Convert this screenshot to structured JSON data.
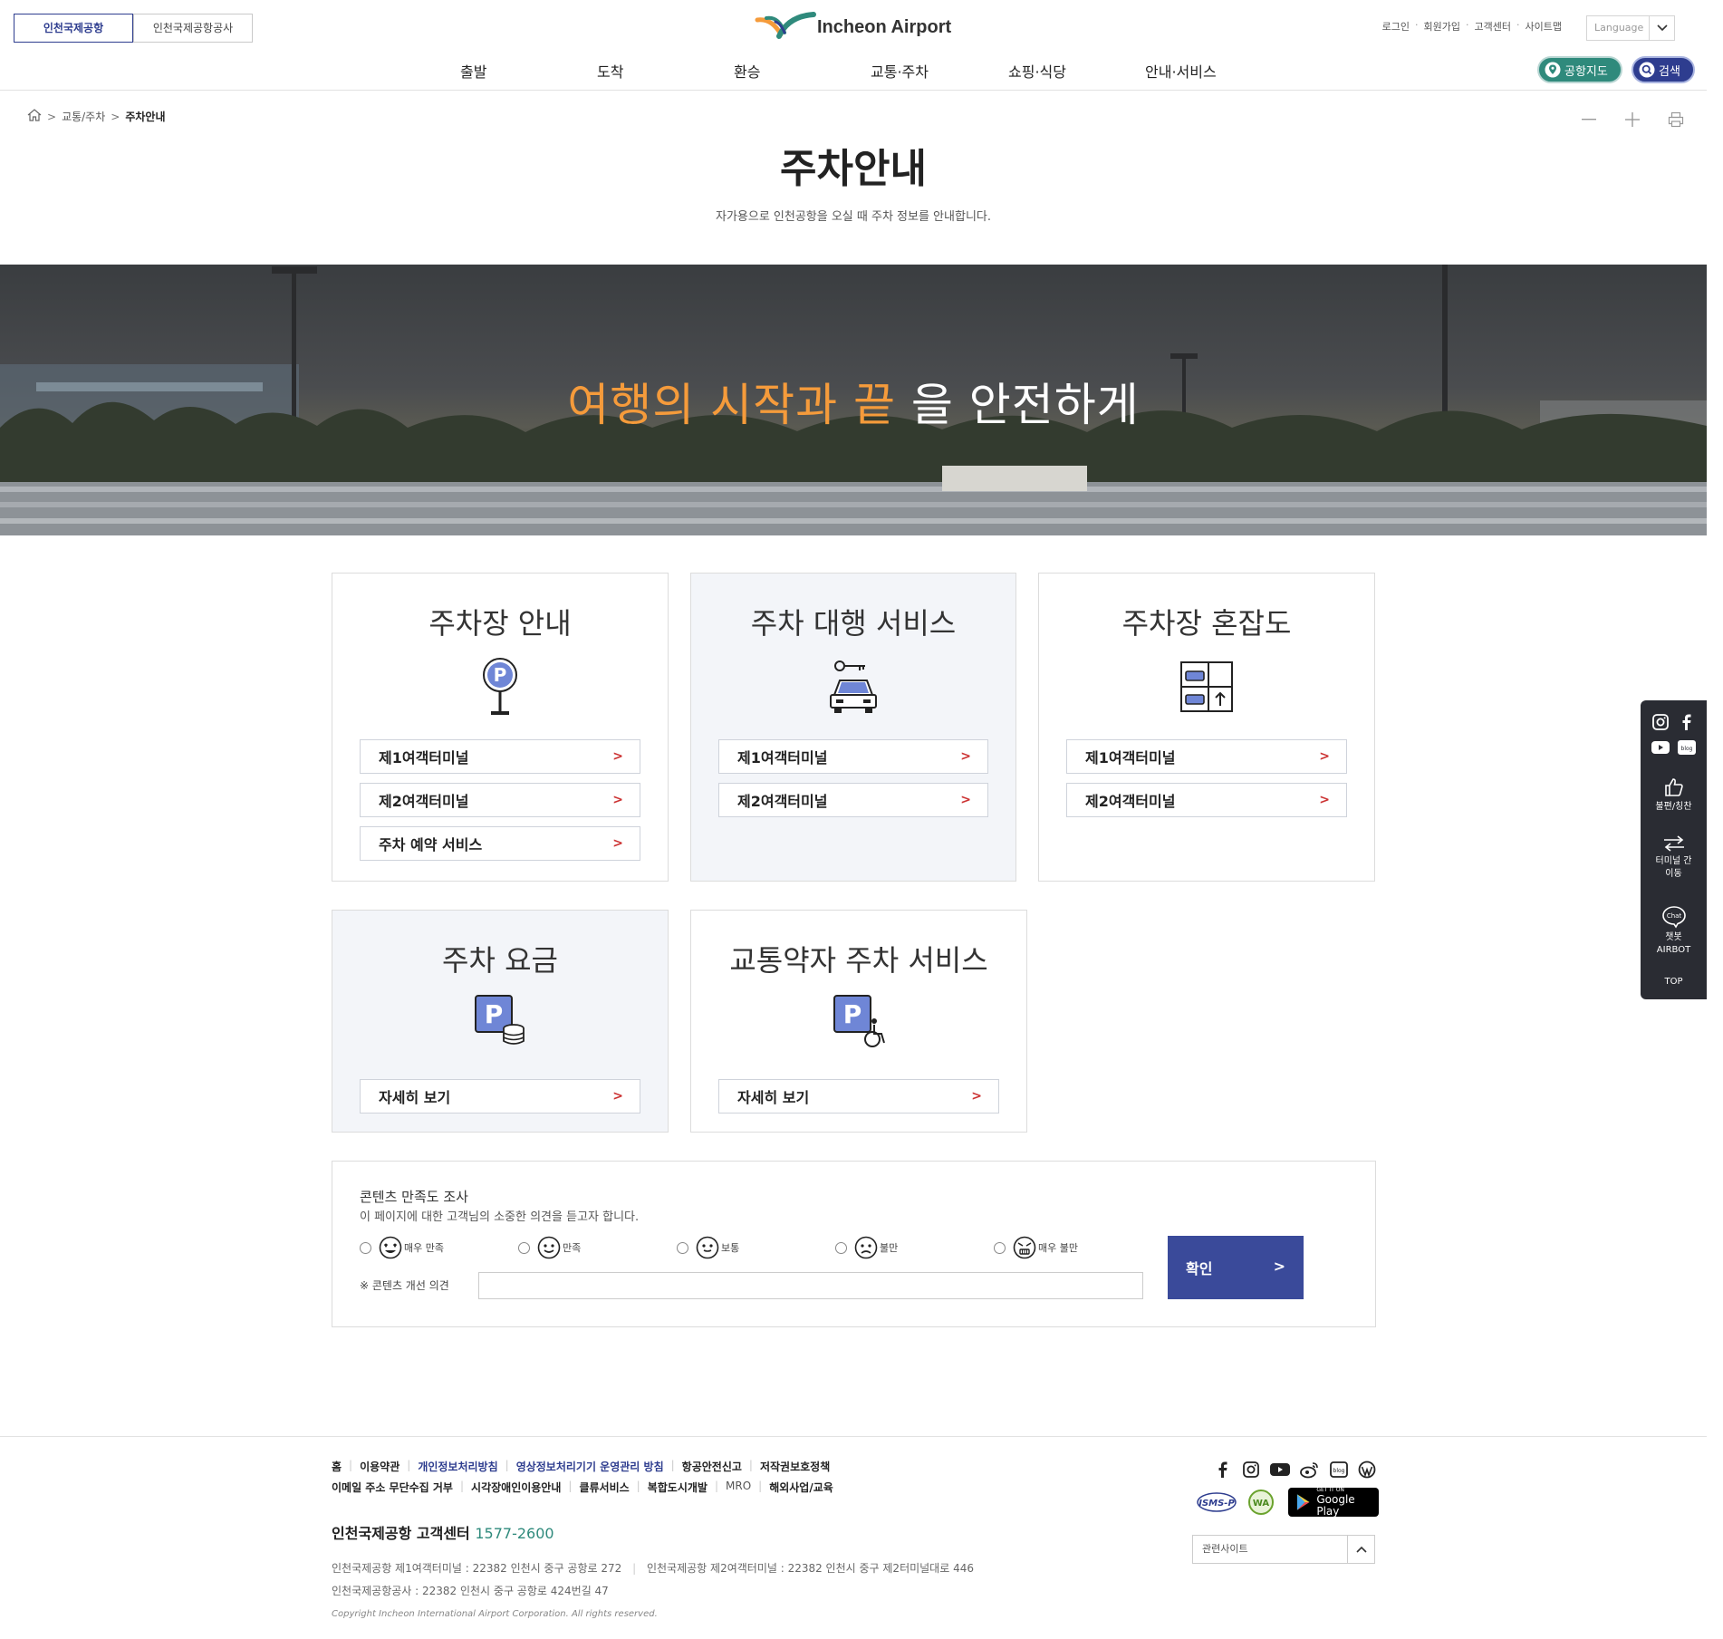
{
  "header": {
    "site_tabs": [
      "인천국제공항",
      "인천국제공항공사"
    ],
    "logo_text": "Incheon Airport",
    "util_links": [
      "로그인",
      "회원가입",
      "고객센터",
      "사이트맵"
    ],
    "language_placeholder": "Language",
    "nav": [
      "출발",
      "도착",
      "환승",
      "교통·주차",
      "쇼핑·식당",
      "안내·서비스"
    ],
    "map_button": "공항지도",
    "search_button": "검색"
  },
  "breadcrumb": [
    "교통/주차",
    "주차안내"
  ],
  "page": {
    "title": "주차안내",
    "description": "자가용으로 인천공항을 오실 때 주차 정보를 안내합니다."
  },
  "hero": {
    "highlight": "여행의 시작과 끝",
    "rest": " 을 안전하게"
  },
  "cards": [
    {
      "title": "주차장 안내",
      "links": [
        "제1여객터미널",
        "제2여객터미널",
        "주차 예약 서비스"
      ]
    },
    {
      "title": "주차 대행 서비스",
      "links": [
        "제1여객터미널",
        "제2여객터미널"
      ]
    },
    {
      "title": "주차장 혼잡도",
      "links": [
        "제1여객터미널",
        "제2여객터미널"
      ]
    },
    {
      "title": "주차 요금",
      "links": [
        "자세히 보기"
      ]
    },
    {
      "title": "교통약자 주차 서비스",
      "links": [
        "자세히 보기"
      ]
    }
  ],
  "survey": {
    "title": "콘텐츠 만족도 조사",
    "description": "이 페이지에 대한 고객님의 소중한 의견을 듣고자 합니다.",
    "options": [
      "매우 만족",
      "만족",
      "보통",
      "불만",
      "매우 불만"
    ],
    "opinion_label": "※ 콘텐츠 개선 의견",
    "confirm": "확인"
  },
  "sidebar": {
    "praise": "불편/칭찬",
    "terminal_move_1": "터미널 간",
    "terminal_move_2": "이동",
    "chat_icon_text": "Chat",
    "chatbot_1": "챗봇",
    "chatbot_2": "AIRBOT",
    "top": "TOP",
    "blog_icon_text": "blog"
  },
  "footer": {
    "links_row1": [
      "홈",
      "이용약관",
      "개인정보처리방침",
      "영상정보처리기기 운영관리 방침",
      "항공안전신고",
      "저작권보호정책"
    ],
    "links_row2": [
      "이메일 주소 무단수집 거부",
      "시각장애인이용안내",
      "클류서비스",
      "복합도시개발",
      "MRO",
      "해외사업/교육"
    ],
    "cs_label": "인천국제공항 고객센터",
    "cs_tel": "1577-2600",
    "address1": "인천국제공항 제1여객터미널 : 22382 인천시 중구 공항로 272",
    "address2": "인천국제공항 제2여객터미널 : 22382 인천시 중구 제2터미널대로 446",
    "address3": "인천국제공항공사 : 22382 인천시 중구 공항로 424번길 47",
    "copyright": "Copyright Incheon International Airport Corporation. All rights reserved.",
    "isms_label": "ISMS-P",
    "wa_label": "WA",
    "gplay_top": "GET IT ON",
    "gplay_bottom": "Google Play",
    "related": "관련사이트"
  },
  "colors": {
    "brand_blue": "#2e3d8f",
    "brand_green": "#2f8a7c",
    "hero_highlight": "#f59b3b",
    "card_grey": "#f3f5f9"
  }
}
